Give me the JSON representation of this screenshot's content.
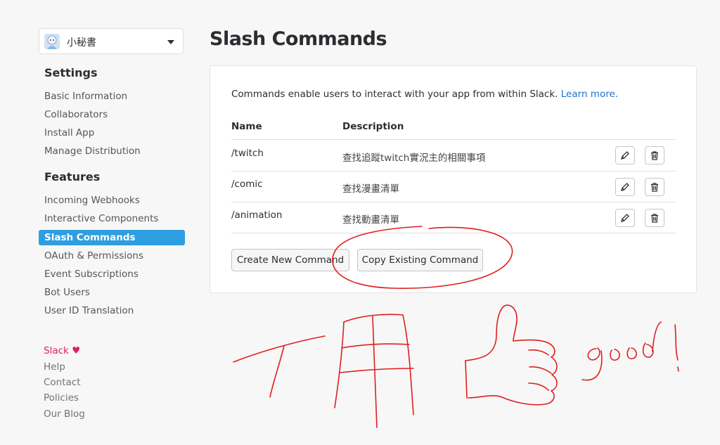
{
  "app": {
    "name": "小秘書"
  },
  "sidebar": {
    "settings_heading": "Settings",
    "settings_items": [
      {
        "label": "Basic Information"
      },
      {
        "label": "Collaborators"
      },
      {
        "label": "Install App"
      },
      {
        "label": "Manage Distribution"
      }
    ],
    "features_heading": "Features",
    "features_items": [
      {
        "label": "Incoming Webhooks"
      },
      {
        "label": "Interactive Components"
      },
      {
        "label": "Slash Commands",
        "active": true
      },
      {
        "label": "OAuth & Permissions"
      },
      {
        "label": "Event Subscriptions"
      },
      {
        "label": "Bot Users"
      },
      {
        "label": "User ID Translation"
      }
    ],
    "footer": [
      {
        "label": "Slack ♥"
      },
      {
        "label": "Help"
      },
      {
        "label": "Contact"
      },
      {
        "label": "Policies"
      },
      {
        "label": "Our Blog"
      }
    ]
  },
  "main": {
    "title": "Slash Commands",
    "intro": "Commands enable users to interact with your app from within Slack.",
    "learn_more": "Learn more.",
    "columns": {
      "name": "Name",
      "description": "Description"
    },
    "commands": [
      {
        "name": "/twitch",
        "description": "查找追蹤twitch實況主的相關事項"
      },
      {
        "name": "/comic",
        "description": "查找漫畫清單"
      },
      {
        "name": "/animation",
        "description": "查找動畫清單"
      }
    ],
    "create_button": "Create New Command",
    "copy_button": "Copy Existing Command"
  },
  "annotation": {
    "text": "good!",
    "color": "#e01e1e"
  },
  "colors": {
    "accent": "#2d9ee0",
    "link": "#1d74c9",
    "slack_heart": "#e01e5a"
  },
  "icons": {
    "edit": "pencil-icon",
    "delete": "trash-icon",
    "dropdown": "chevron-down-icon"
  }
}
